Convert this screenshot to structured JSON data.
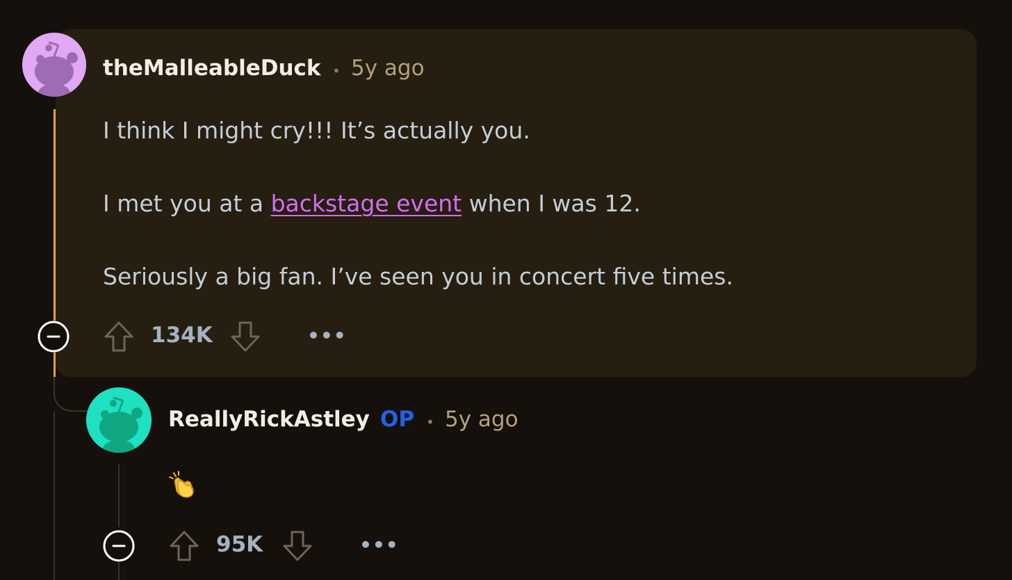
{
  "comment": {
    "author": "theMalleableDuck",
    "separator": "•",
    "time": "5y ago",
    "paragraphs": {
      "p1": "I think I might cry!!! It’s actually you.",
      "p2_before": "I met you at a ",
      "p2_link": "backstage event",
      "p2_after": " when I was 12.",
      "p3": "Seriously a big fan. I’ve seen you in concert five times."
    },
    "score": "134K",
    "more": "•••",
    "avatar_color": "#e1a8f5",
    "thread_color": "#e6a530"
  },
  "reply": {
    "author": "ReallyRickAstley",
    "op_badge": "OP",
    "separator": "•",
    "time": "5y ago",
    "body_emoji": "clapping-hands",
    "score": "95K",
    "more": "•••",
    "avatar_color": "#1fe0c0"
  },
  "icons": {
    "upvote": "arrow-up-icon",
    "downvote": "arrow-down-icon",
    "collapse": "minus-circle-icon",
    "more": "ellipsis-icon"
  }
}
